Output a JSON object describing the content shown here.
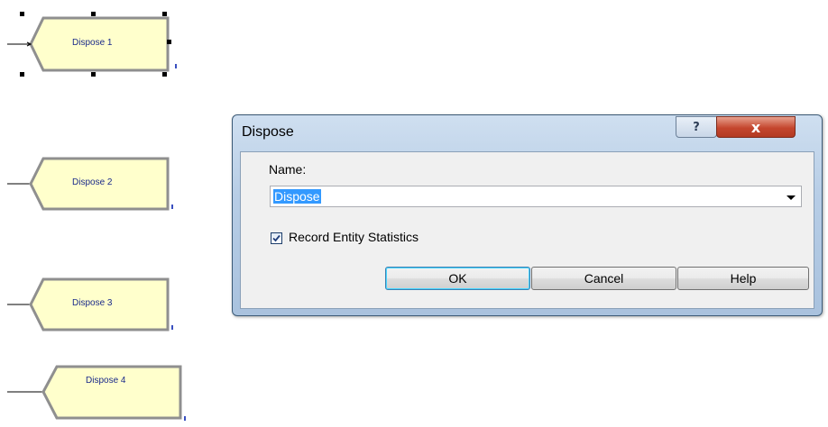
{
  "modules": [
    {
      "label": "Dispose 1"
    },
    {
      "label": "Dispose 2"
    },
    {
      "label": "Dispose 3"
    },
    {
      "label": "Dispose 4"
    }
  ],
  "dialog": {
    "title": "Dispose",
    "help_caption": "?",
    "close_caption": "x",
    "name_label": "Name:",
    "name_value": "Dispose",
    "record_label": "Record Entity Statistics",
    "record_checked": true,
    "ok_label": "OK",
    "cancel_label": "Cancel",
    "help_label": "Help"
  },
  "colors": {
    "module_fill": "#ffffcc",
    "module_border": "#999999",
    "selection_color": "#3399ff",
    "close_button": "#c4462e"
  },
  "icons": [
    "help-icon",
    "close-icon",
    "checkmark-icon",
    "chevron-down-icon"
  ]
}
